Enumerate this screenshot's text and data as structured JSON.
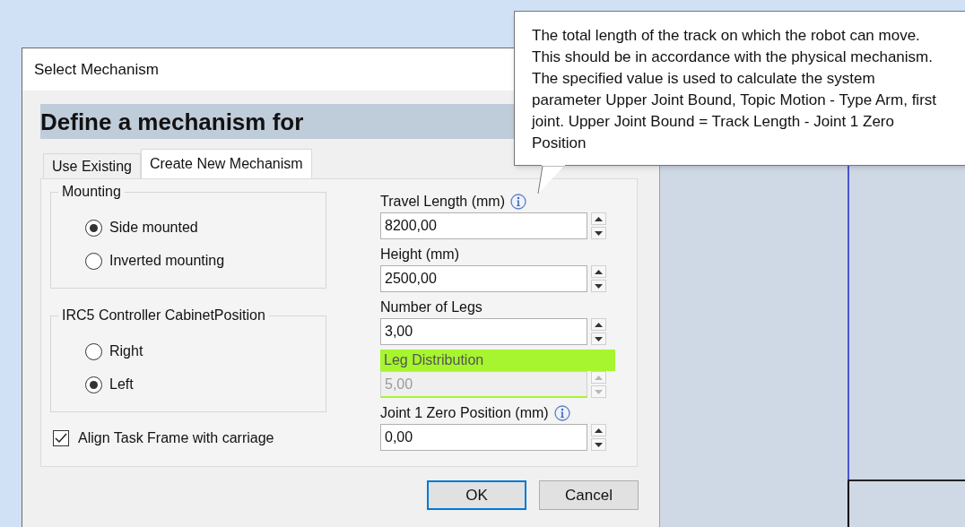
{
  "dialog": {
    "title": "Select Mechanism",
    "heading": "Define a mechanism for",
    "tabs": [
      {
        "label": "Use Existing",
        "selected": false
      },
      {
        "label": "Create New Mechanism",
        "selected": true
      }
    ],
    "groups": [
      {
        "title": "Mounting",
        "options": [
          {
            "label": "Side mounted",
            "selected": true
          },
          {
            "label": "Inverted mounting",
            "selected": false
          }
        ]
      },
      {
        "title": "IRC5 Controller CabinetPosition",
        "options": [
          {
            "label": "Right",
            "selected": false
          },
          {
            "label": "Left",
            "selected": true
          }
        ]
      }
    ],
    "checkbox": {
      "label": "Align Task Frame with carriage",
      "checked": true
    },
    "fields": [
      {
        "label": "Travel Length (mm)",
        "value": "8200,00",
        "info": true,
        "disabled": false,
        "highlighted": false
      },
      {
        "label": "Height (mm)",
        "value": "2500,00",
        "info": false,
        "disabled": false,
        "highlighted": false
      },
      {
        "label": "Number of Legs",
        "value": "3,00",
        "info": false,
        "disabled": false,
        "highlighted": false
      },
      {
        "label": "Leg Distribution",
        "value": "5,00",
        "info": false,
        "disabled": true,
        "highlighted": true
      },
      {
        "label": "Joint 1 Zero Position (mm)",
        "value": "0,00",
        "info": true,
        "disabled": false,
        "highlighted": false
      }
    ],
    "buttons": [
      {
        "label": "OK",
        "default": true
      },
      {
        "label": "Cancel",
        "default": false
      }
    ]
  },
  "tooltip": {
    "text": "The total length of the track on which the robot can move. This should be in accordance with the physical mechanism. The specified value is used to calculate the system parameter Upper Joint Bound, Topic Motion - Type Arm, first joint. Upper Joint Bound = Track Length - Joint 1 Zero Position"
  }
}
